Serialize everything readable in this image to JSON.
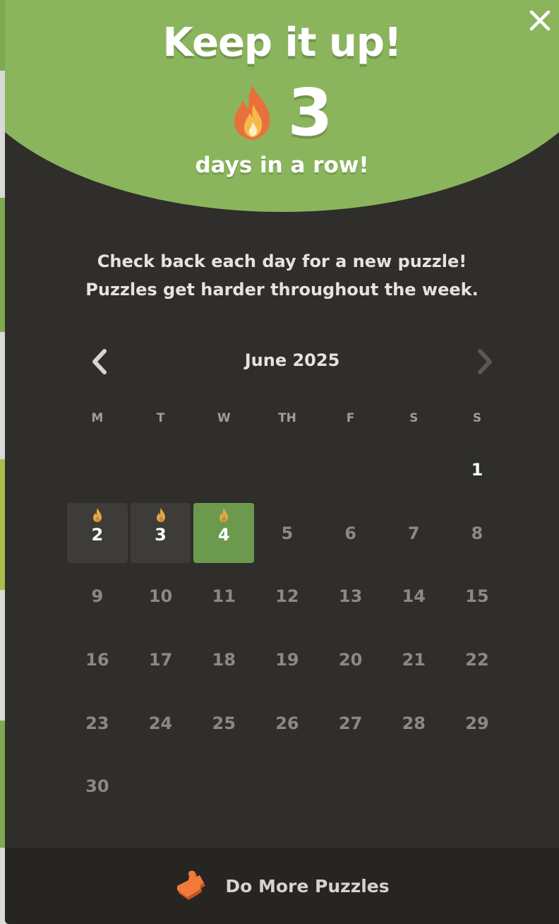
{
  "modal": {
    "close_icon": "close-icon",
    "headline": "Keep it up!",
    "streak": {
      "icon": "flame-icon",
      "count": "3",
      "caption": "days in a row!"
    },
    "message_line_1": "Check back each day for a new puzzle!",
    "message_line_2": "Puzzles get harder throughout the week."
  },
  "calendar": {
    "month_label": "June 2025",
    "prev_icon": "chevron-left-icon",
    "next_icon": "chevron-right-icon",
    "weekdays": [
      "M",
      "T",
      "W",
      "TH",
      "F",
      "S",
      "S"
    ],
    "leading_blanks": 6,
    "days_in_month": 30,
    "streak_days": [
      2,
      3
    ],
    "today": 4,
    "available_days": [
      1
    ],
    "day_labels": [
      "1",
      "2",
      "3",
      "4",
      "5",
      "6",
      "7",
      "8",
      "9",
      "10",
      "11",
      "12",
      "13",
      "14",
      "15",
      "16",
      "17",
      "18",
      "19",
      "20",
      "21",
      "22",
      "23",
      "24",
      "25",
      "26",
      "27",
      "28",
      "29",
      "30"
    ]
  },
  "footer": {
    "icon": "puzzle-piece-icon",
    "label": "Do More Puzzles"
  },
  "colors": {
    "banner_green": "#8bb55c",
    "modal_bg": "#2f2e2b",
    "today_green": "#6b9a4e",
    "streak_cell": "#3d3c39",
    "footer_bg": "#262522",
    "flame_orange": "#e8713b",
    "flame_gold": "#e0a845"
  }
}
